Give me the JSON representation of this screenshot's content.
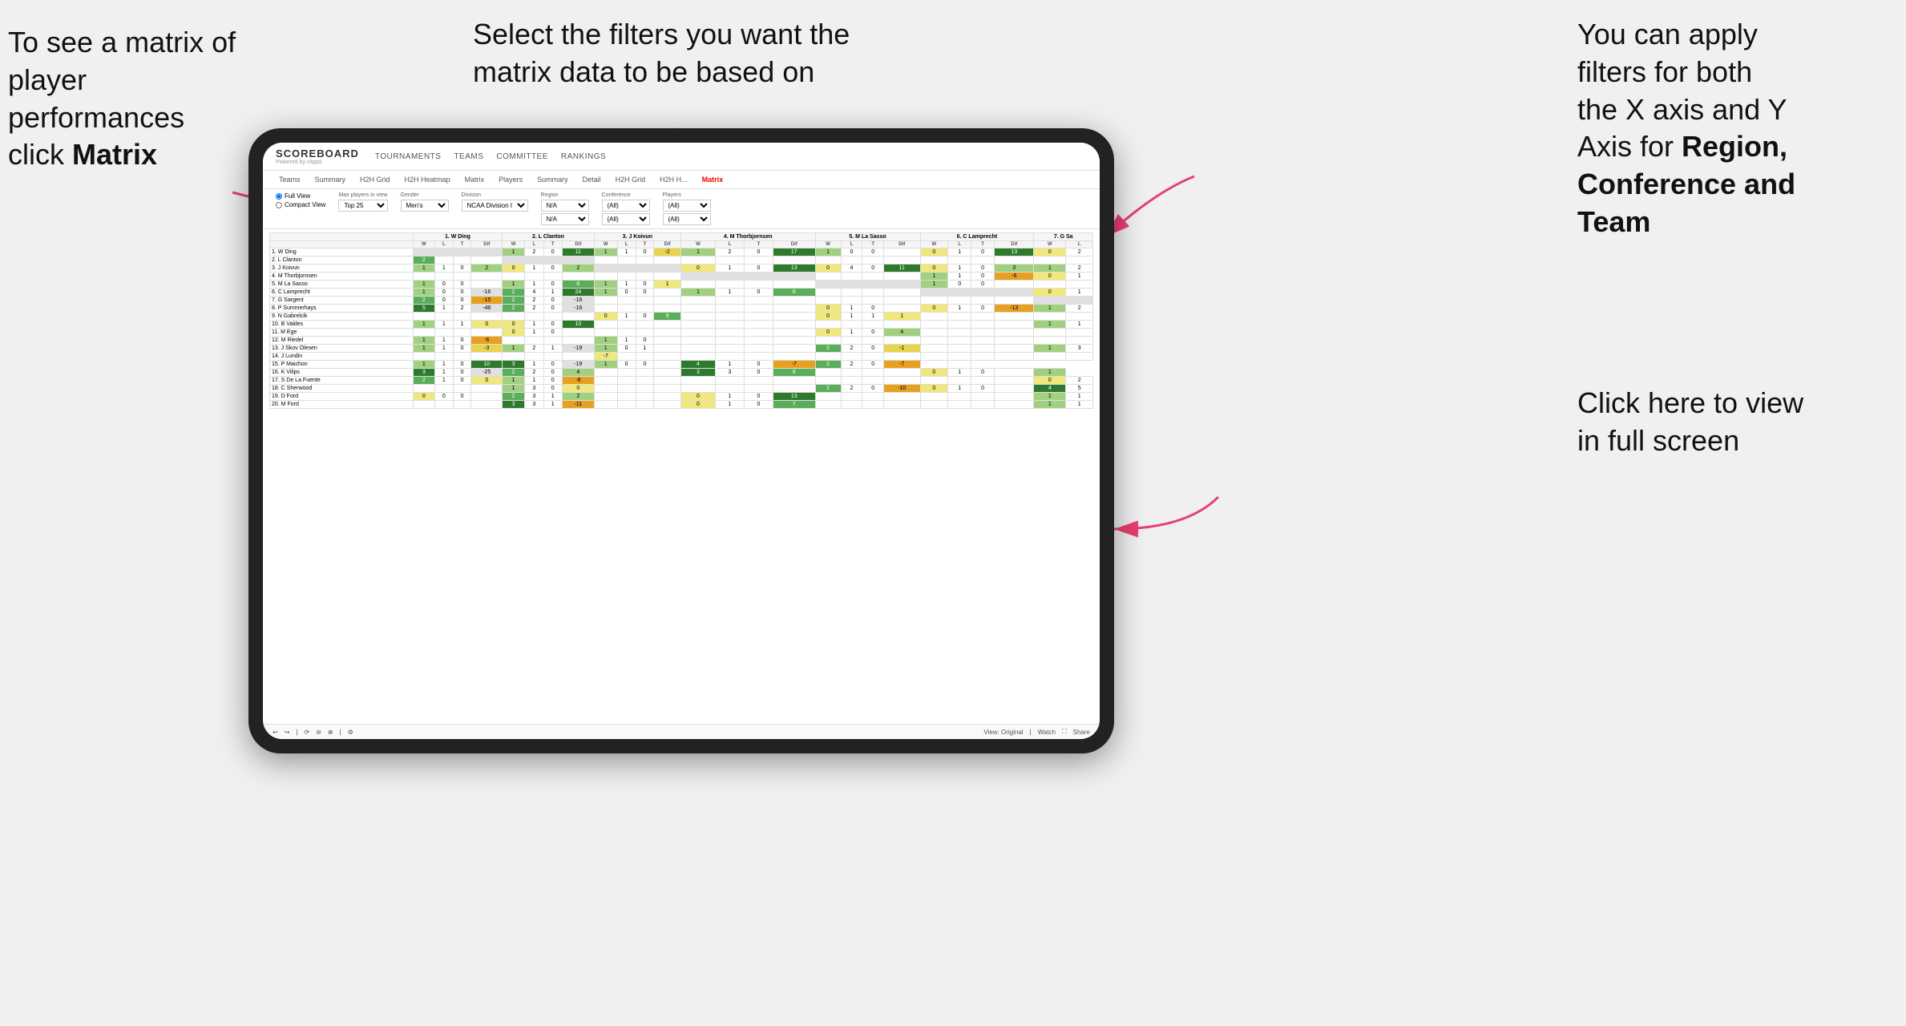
{
  "annotations": {
    "left": {
      "line1": "To see a matrix of",
      "line2": "player performances",
      "line3_prefix": "click ",
      "line3_bold": "Matrix"
    },
    "center": {
      "text": "Select the filters you want the matrix data to be based on"
    },
    "right_top": {
      "line1": "You  can apply",
      "line2": "filters for both",
      "line3": "the X axis and Y",
      "line4_prefix": "Axis for ",
      "line4_bold": "Region,",
      "line5_bold": "Conference and",
      "line6_bold": "Team"
    },
    "right_bottom": {
      "line1": "Click here to view",
      "line2": "in full screen"
    }
  },
  "header": {
    "logo_title": "SCOREBOARD",
    "logo_sub": "Powered by clippd",
    "nav": [
      "TOURNAMENTS",
      "TEAMS",
      "COMMITTEE",
      "RANKINGS"
    ]
  },
  "sub_nav": {
    "items": [
      "Teams",
      "Summary",
      "H2H Grid",
      "H2H Heatmap",
      "Matrix",
      "Players",
      "Summary",
      "Detail",
      "H2H Grid",
      "H2H H...",
      "Matrix"
    ],
    "active_index": 10
  },
  "filters": {
    "view_options": [
      "Full View",
      "Compact View"
    ],
    "selected_view": "Full View",
    "max_players_label": "Max players in view",
    "max_players_value": "Top 25",
    "gender_label": "Gender",
    "gender_value": "Men's",
    "division_label": "Division",
    "division_value": "NCAA Division I",
    "region_label": "Region",
    "region_value": "N/A",
    "conference_label": "Conference",
    "conference_value": "(All)",
    "players_label": "Players",
    "players_value": "(All)"
  },
  "matrix": {
    "col_headers": [
      "1. W Ding",
      "2. L Clanton",
      "3. J Koivun",
      "4. M Thorbjornsen",
      "5. M La Sasso",
      "6. C Lamprecht",
      "7. G Sa"
    ],
    "sub_headers": [
      "W",
      "L",
      "T",
      "Dif"
    ],
    "rows": [
      {
        "name": "1. W Ding",
        "cells": [
          "",
          "",
          "",
          "",
          "1",
          "2",
          "0",
          "11",
          "1",
          "1",
          "0",
          "-2",
          "1",
          "2",
          "0",
          "17",
          "1",
          "0",
          "0",
          "",
          "0",
          "1",
          "0",
          "13",
          "0",
          "2"
        ]
      },
      {
        "name": "2. L Clanton",
        "cells": [
          "2",
          "",
          "",
          "",
          "",
          "",
          "",
          "",
          "",
          "",
          "",
          "",
          "",
          "",
          "",
          "",
          "",
          "",
          "",
          "",
          "",
          "",
          "",
          "",
          "",
          ""
        ]
      },
      {
        "name": "3. J Koivun",
        "cells": [
          "1",
          "1",
          "0",
          "2",
          "0",
          "1",
          "0",
          "2",
          "",
          "",
          "",
          "",
          "0",
          "1",
          "0",
          "13",
          "0",
          "4",
          "0",
          "11",
          "0",
          "1",
          "0",
          "3",
          "1",
          "2"
        ]
      },
      {
        "name": "4. M Thorbjornsen",
        "cells": [
          "",
          "",
          "",
          "",
          "",
          "",
          "",
          "",
          "",
          "",
          "",
          "",
          "",
          "",
          "",
          "",
          "",
          "",
          "",
          "",
          "1",
          "1",
          "0",
          "-6",
          "0",
          "1"
        ]
      },
      {
        "name": "5. M La Sasso",
        "cells": [
          "1",
          "0",
          "0",
          "",
          "1",
          "1",
          "0",
          "6",
          "1",
          "1",
          "0",
          "1",
          "",
          "",
          "",
          "",
          "",
          "",
          "",
          "",
          "1",
          "0",
          "0",
          "",
          "",
          ""
        ]
      },
      {
        "name": "6. C Lamprecht",
        "cells": [
          "1",
          "0",
          "0",
          "-16",
          "2",
          "4",
          "1",
          "24",
          "1",
          "0",
          "0",
          "",
          "1",
          "1",
          "0",
          "6",
          "",
          "",
          "",
          "",
          "",
          "",
          "",
          "",
          "0",
          "1"
        ]
      },
      {
        "name": "7. G Sargent",
        "cells": [
          "2",
          "0",
          "0",
          "-15",
          "2",
          "2",
          "0",
          "-16",
          "",
          "",
          "",
          "",
          "",
          "",
          "",
          "",
          "",
          "",
          "",
          "",
          "",
          "",
          "",
          "",
          "",
          ""
        ]
      },
      {
        "name": "8. P Summerhays",
        "cells": [
          "5",
          "1",
          "2",
          "-48",
          "2",
          "2",
          "0",
          "-16",
          "",
          "",
          "",
          "",
          "",
          "",
          "",
          "",
          "0",
          "1",
          "0",
          "",
          "0",
          "1",
          "0",
          "-13",
          "1",
          "2"
        ]
      },
      {
        "name": "9. N Gabrelcik",
        "cells": [
          "",
          "",
          "",
          "",
          "",
          "",
          "",
          "",
          "0",
          "1",
          "0",
          "9",
          "",
          "",
          "",
          "",
          "0",
          "1",
          "1",
          "1",
          "",
          "",
          "",
          "",
          "",
          ""
        ]
      },
      {
        "name": "10. B Valdes",
        "cells": [
          "1",
          "1",
          "1",
          "0",
          "0",
          "1",
          "0",
          "10",
          "",
          "",
          "",
          "",
          "",
          "",
          "",
          "",
          "",
          "",
          "",
          "",
          "",
          "",
          "",
          "",
          "1",
          "1"
        ]
      },
      {
        "name": "11. M Ege",
        "cells": [
          "",
          "",
          "",
          "",
          "0",
          "1",
          "0",
          "",
          "",
          "",
          "",
          "",
          "",
          "",
          "",
          "",
          "0",
          "1",
          "0",
          "4",
          "",
          "",
          "",
          "",
          "",
          ""
        ]
      },
      {
        "name": "12. M Riedel",
        "cells": [
          "1",
          "1",
          "0",
          "-6",
          "",
          "",
          "",
          "",
          "1",
          "1",
          "0",
          "",
          "",
          "",
          "",
          "",
          "",
          "",
          "",
          "",
          "",
          "",
          "",
          "",
          "",
          ""
        ]
      },
      {
        "name": "13. J Skov Olesen",
        "cells": [
          "1",
          "1",
          "0",
          "-3",
          "1",
          "2",
          "1",
          "-19",
          "1",
          "0",
          "1",
          "",
          "",
          "",
          "",
          "",
          "2",
          "2",
          "0",
          "-1",
          "",
          "",
          "",
          "",
          "1",
          "3"
        ]
      },
      {
        "name": "14. J Lundin",
        "cells": [
          "",
          "",
          "",
          "",
          "",
          "",
          "",
          "",
          "-7",
          "",
          "",
          "",
          "",
          "",
          "",
          "",
          "",
          "",
          "",
          "",
          "",
          "",
          "",
          "",
          "",
          ""
        ]
      },
      {
        "name": "15. P Maichon",
        "cells": [
          "1",
          "1",
          "0",
          "10",
          "3",
          "1",
          "0",
          "-19",
          "1",
          "0",
          "0",
          "",
          "4",
          "1",
          "0",
          "-7",
          "2",
          "2",
          "0",
          "-7",
          "",
          ""
        ]
      },
      {
        "name": "16. K Vilips",
        "cells": [
          "3",
          "1",
          "0",
          "-25",
          "2",
          "2",
          "0",
          "4",
          "",
          "",
          "",
          "",
          "3",
          "3",
          "0",
          "8",
          "",
          "",
          "",
          "",
          "0",
          "1",
          "0",
          "",
          "1"
        ]
      },
      {
        "name": "17. S De La Fuente",
        "cells": [
          "2",
          "1",
          "0",
          "0",
          "1",
          "1",
          "0",
          "-8",
          "",
          "",
          "",
          "",
          "",
          "",
          "",
          "",
          "",
          "",
          "",
          "",
          "",
          "",
          "",
          "",
          "0",
          "2"
        ]
      },
      {
        "name": "18. C Sherwood",
        "cells": [
          "",
          "",
          "",
          "",
          "1",
          "3",
          "0",
          "0",
          "",
          "",
          "",
          "",
          "",
          "",
          "",
          "",
          "2",
          "2",
          "0",
          "-10",
          "0",
          "1",
          "0",
          "",
          "4",
          "5"
        ]
      },
      {
        "name": "19. D Ford",
        "cells": [
          "0",
          "0",
          "0",
          "",
          "2",
          "3",
          "1",
          "2",
          "",
          "",
          "",
          "",
          "0",
          "1",
          "0",
          "13",
          "",
          "",
          "",
          "",
          "",
          "",
          "",
          "",
          "1",
          "1"
        ]
      },
      {
        "name": "20. M Ford",
        "cells": [
          "",
          "",
          "",
          "",
          "3",
          "3",
          "1",
          "-11",
          "",
          "",
          "",
          "",
          "0",
          "1",
          "0",
          "7",
          "",
          "",
          "",
          "",
          "",
          "",
          "",
          "",
          "1",
          "1"
        ]
      }
    ]
  },
  "bottom_toolbar": {
    "view_label": "View: Original",
    "watch_label": "Watch",
    "share_label": "Share"
  }
}
